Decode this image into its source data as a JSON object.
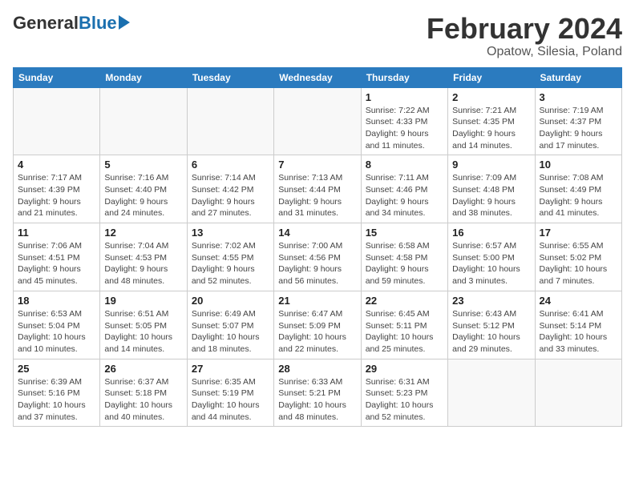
{
  "header": {
    "logo_general": "General",
    "logo_blue": "Blue",
    "month_year": "February 2024",
    "location": "Opatow, Silesia, Poland"
  },
  "days_of_week": [
    "Sunday",
    "Monday",
    "Tuesday",
    "Wednesday",
    "Thursday",
    "Friday",
    "Saturday"
  ],
  "weeks": [
    [
      {
        "day": "",
        "info": ""
      },
      {
        "day": "",
        "info": ""
      },
      {
        "day": "",
        "info": ""
      },
      {
        "day": "",
        "info": ""
      },
      {
        "day": "1",
        "info": "Sunrise: 7:22 AM\nSunset: 4:33 PM\nDaylight: 9 hours\nand 11 minutes."
      },
      {
        "day": "2",
        "info": "Sunrise: 7:21 AM\nSunset: 4:35 PM\nDaylight: 9 hours\nand 14 minutes."
      },
      {
        "day": "3",
        "info": "Sunrise: 7:19 AM\nSunset: 4:37 PM\nDaylight: 9 hours\nand 17 minutes."
      }
    ],
    [
      {
        "day": "4",
        "info": "Sunrise: 7:17 AM\nSunset: 4:39 PM\nDaylight: 9 hours\nand 21 minutes."
      },
      {
        "day": "5",
        "info": "Sunrise: 7:16 AM\nSunset: 4:40 PM\nDaylight: 9 hours\nand 24 minutes."
      },
      {
        "day": "6",
        "info": "Sunrise: 7:14 AM\nSunset: 4:42 PM\nDaylight: 9 hours\nand 27 minutes."
      },
      {
        "day": "7",
        "info": "Sunrise: 7:13 AM\nSunset: 4:44 PM\nDaylight: 9 hours\nand 31 minutes."
      },
      {
        "day": "8",
        "info": "Sunrise: 7:11 AM\nSunset: 4:46 PM\nDaylight: 9 hours\nand 34 minutes."
      },
      {
        "day": "9",
        "info": "Sunrise: 7:09 AM\nSunset: 4:48 PM\nDaylight: 9 hours\nand 38 minutes."
      },
      {
        "day": "10",
        "info": "Sunrise: 7:08 AM\nSunset: 4:49 PM\nDaylight: 9 hours\nand 41 minutes."
      }
    ],
    [
      {
        "day": "11",
        "info": "Sunrise: 7:06 AM\nSunset: 4:51 PM\nDaylight: 9 hours\nand 45 minutes."
      },
      {
        "day": "12",
        "info": "Sunrise: 7:04 AM\nSunset: 4:53 PM\nDaylight: 9 hours\nand 48 minutes."
      },
      {
        "day": "13",
        "info": "Sunrise: 7:02 AM\nSunset: 4:55 PM\nDaylight: 9 hours\nand 52 minutes."
      },
      {
        "day": "14",
        "info": "Sunrise: 7:00 AM\nSunset: 4:56 PM\nDaylight: 9 hours\nand 56 minutes."
      },
      {
        "day": "15",
        "info": "Sunrise: 6:58 AM\nSunset: 4:58 PM\nDaylight: 9 hours\nand 59 minutes."
      },
      {
        "day": "16",
        "info": "Sunrise: 6:57 AM\nSunset: 5:00 PM\nDaylight: 10 hours\nand 3 minutes."
      },
      {
        "day": "17",
        "info": "Sunrise: 6:55 AM\nSunset: 5:02 PM\nDaylight: 10 hours\nand 7 minutes."
      }
    ],
    [
      {
        "day": "18",
        "info": "Sunrise: 6:53 AM\nSunset: 5:04 PM\nDaylight: 10 hours\nand 10 minutes."
      },
      {
        "day": "19",
        "info": "Sunrise: 6:51 AM\nSunset: 5:05 PM\nDaylight: 10 hours\nand 14 minutes."
      },
      {
        "day": "20",
        "info": "Sunrise: 6:49 AM\nSunset: 5:07 PM\nDaylight: 10 hours\nand 18 minutes."
      },
      {
        "day": "21",
        "info": "Sunrise: 6:47 AM\nSunset: 5:09 PM\nDaylight: 10 hours\nand 22 minutes."
      },
      {
        "day": "22",
        "info": "Sunrise: 6:45 AM\nSunset: 5:11 PM\nDaylight: 10 hours\nand 25 minutes."
      },
      {
        "day": "23",
        "info": "Sunrise: 6:43 AM\nSunset: 5:12 PM\nDaylight: 10 hours\nand 29 minutes."
      },
      {
        "day": "24",
        "info": "Sunrise: 6:41 AM\nSunset: 5:14 PM\nDaylight: 10 hours\nand 33 minutes."
      }
    ],
    [
      {
        "day": "25",
        "info": "Sunrise: 6:39 AM\nSunset: 5:16 PM\nDaylight: 10 hours\nand 37 minutes."
      },
      {
        "day": "26",
        "info": "Sunrise: 6:37 AM\nSunset: 5:18 PM\nDaylight: 10 hours\nand 40 minutes."
      },
      {
        "day": "27",
        "info": "Sunrise: 6:35 AM\nSunset: 5:19 PM\nDaylight: 10 hours\nand 44 minutes."
      },
      {
        "day": "28",
        "info": "Sunrise: 6:33 AM\nSunset: 5:21 PM\nDaylight: 10 hours\nand 48 minutes."
      },
      {
        "day": "29",
        "info": "Sunrise: 6:31 AM\nSunset: 5:23 PM\nDaylight: 10 hours\nand 52 minutes."
      },
      {
        "day": "",
        "info": ""
      },
      {
        "day": "",
        "info": ""
      }
    ]
  ]
}
